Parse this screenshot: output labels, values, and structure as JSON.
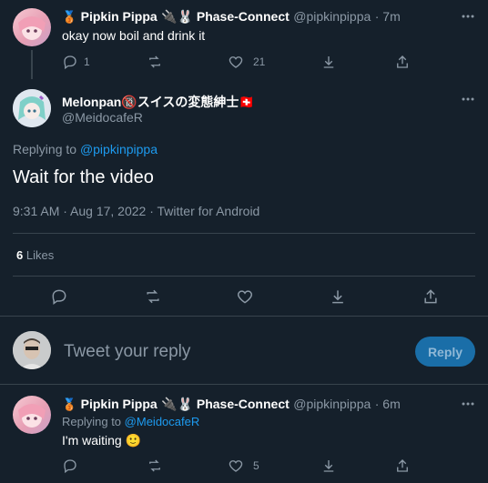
{
  "tweet1": {
    "medal": "🥉",
    "name": "Pipkin Pippa",
    "suffix": "🔌🐰 Phase-Connect",
    "handle": "@pipkinpippa",
    "time": "· 7m",
    "text": "okay now boil and drink it",
    "actions": {
      "reply": "1",
      "retweet": "",
      "like": "21"
    }
  },
  "main": {
    "name": "Melonpan🔞スイスの変態紳士🇨🇭",
    "handle": "@MeidocafeR",
    "replying_prefix": "Replying to",
    "replying_to": "@pipkinpippa",
    "text": "Wait for the video",
    "meta": "9:31 AM · Aug 17, 2022 · Twitter for Android",
    "likes_count": "6",
    "likes_label": "Likes"
  },
  "compose": {
    "placeholder": "Tweet your reply",
    "button": "Reply"
  },
  "tweet2": {
    "medal": "🥉",
    "name": "Pipkin Pippa",
    "suffix": "🔌🐰 Phase-Connect",
    "handle": "@pipkinpippa",
    "time": "· 6m",
    "replying_prefix": "Replying to",
    "replying_to": "@MeidocafeR",
    "text": "I'm waiting 🙂",
    "actions": {
      "reply": "",
      "retweet": "",
      "like": "5"
    }
  },
  "colors": {
    "background": "#15202b",
    "accent": "#1d9bf0",
    "muted": "#8b98a5",
    "divider": "#38444d"
  }
}
